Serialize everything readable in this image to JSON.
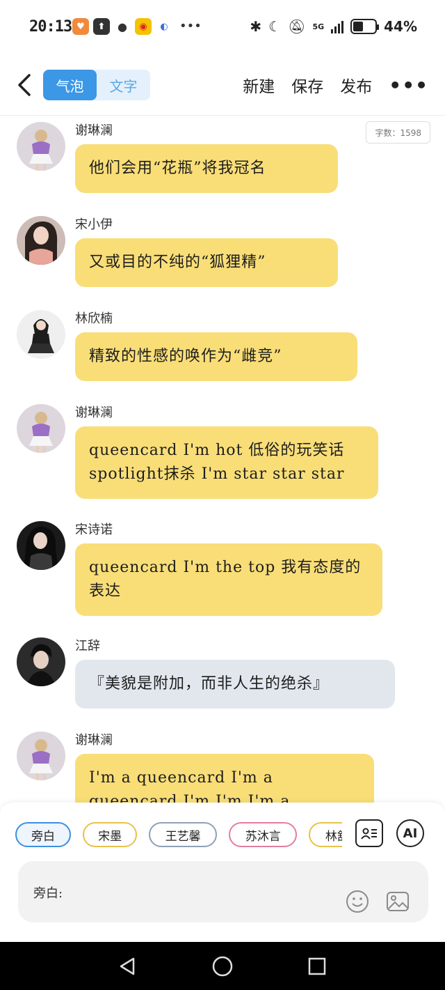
{
  "status_bar": {
    "time": "20:13",
    "network": "5G",
    "battery": "44%",
    "battery_level": 0.44
  },
  "top_bar": {
    "mode_options": [
      "气泡",
      "文字"
    ],
    "active_mode": "气泡",
    "actions": [
      "新建",
      "保存",
      "发布"
    ]
  },
  "word_count": "字数：1598",
  "messages": [
    {
      "sender": "谢琳澜",
      "text": "他们会用“花瓶”将我冠名",
      "style": "yellow"
    },
    {
      "sender": "宋小伊",
      "text": "又或目的不纯的“狐狸精”",
      "style": "yellow"
    },
    {
      "sender": "林欣楠",
      "text": "精致的性感的唤作为“雌竞”",
      "style": "yellow"
    },
    {
      "sender": "谢琳澜",
      "text": "queencard I'm hot 低俗的玩笑话 spotlight抹杀 I'm star star star",
      "style": "yellow"
    },
    {
      "sender": "宋诗诺",
      "text": "queencard I'm the top 我有态度的表达",
      "style": "yellow"
    },
    {
      "sender": "江辞",
      "text": "『美貌是附加，而非人生的绝杀』",
      "style": "grey"
    },
    {
      "sender": "谢琳澜",
      "text": "I'm a queencard   I'm a queencard I'm I'm I'm a queencard I'm a queencard",
      "style": "yellow"
    }
  ],
  "characters": [
    {
      "name": "旁白",
      "color": "#3c8fe0",
      "selected": true
    },
    {
      "name": "宋墨",
      "color": "#e8c14b",
      "selected": false
    },
    {
      "name": "王艺馨",
      "color": "#8ea0b6",
      "selected": false
    },
    {
      "name": "苏沐言",
      "color": "#e37d9f",
      "selected": false
    },
    {
      "name": "林舒妍",
      "color": "#e8c14b",
      "selected": false
    }
  ],
  "ai_label": "AI",
  "input": {
    "label": "旁白:"
  },
  "icons": {
    "contact": "contact-card-icon",
    "emoji": "emoji-icon",
    "image": "image-icon",
    "back": "chevron-left-icon"
  }
}
